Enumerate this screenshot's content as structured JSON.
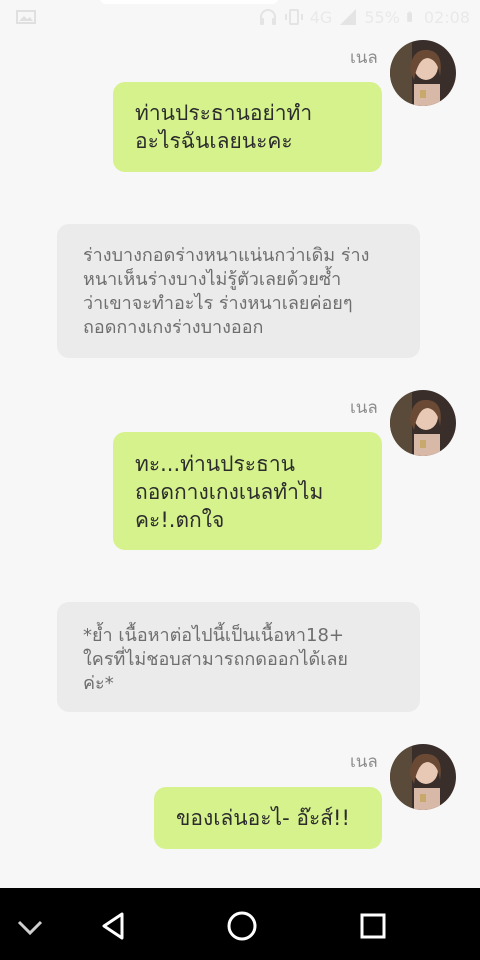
{
  "statusbar": {
    "network": "4G",
    "battery": "55%",
    "time": "02:08",
    "icons": [
      "image-icon",
      "headset-icon",
      "vibrate-icon",
      "signal-icon",
      "battery-icon"
    ]
  },
  "messages": [
    {
      "type": "me",
      "sender": "เนล",
      "lines": [
        "ท่านประธานอย่าทำ",
        "อะไรฉันเลยนะคะ"
      ]
    },
    {
      "type": "narration",
      "lines": [
        "ร่างบางกอดร่างหนาแน่นกว่าเดิม ร่าง",
        "หนาเห็นร่างบางไม่รู้ตัวเลยด้วยซ้ำ",
        "ว่าเขาจะทำอะไร ร่างหนาเลยค่อยๆ",
        "ถอดกางเกงร่างบางออก"
      ]
    },
    {
      "type": "me",
      "sender": "เนล",
      "lines": [
        "ทะ...ท่านประธาน",
        "ถอดกางเกงเนลทำไม",
        "คะ!.ตกใจ"
      ]
    },
    {
      "type": "narration",
      "lines": [
        "*ย้ำ เนื้อหาต่อไปนี้เป็นเนื้อหา18+",
        "ใครที่ไม่ชอบสามารถกดออกได้เลย",
        "ค่ะ*"
      ]
    },
    {
      "type": "me",
      "sender": "เนล",
      "lines": [
        "ของเล่นอะไ- อ๊ะส์!!"
      ]
    }
  ],
  "navbar": [
    "collapse-chevron-icon",
    "back-icon",
    "home-icon",
    "recents-icon"
  ]
}
